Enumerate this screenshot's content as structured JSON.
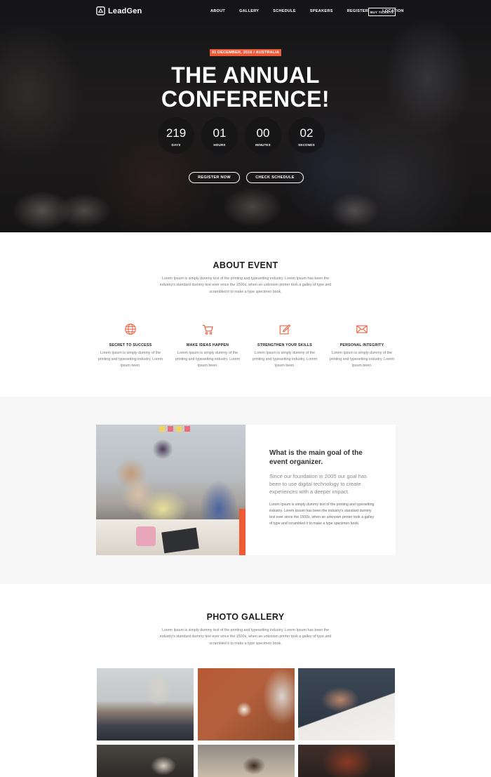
{
  "header": {
    "brand": "LeadGen",
    "nav": [
      "ABOUT",
      "GALLERY",
      "SCHEDULE",
      "SPEAKERS",
      "REGISTER",
      "LOCATION"
    ],
    "cta": "BUY TICKETS"
  },
  "hero": {
    "date_badge": "31 DECEMBER, 2016 / AUSTRALIA",
    "title_line1": "THE ANNUAL",
    "title_line2": "CONFERENCE!",
    "countdown": [
      {
        "value": "219",
        "label": "DAYS"
      },
      {
        "value": "01",
        "label": "HOURS"
      },
      {
        "value": "00",
        "label": "MINUTES"
      },
      {
        "value": "02",
        "label": "SECONDS"
      }
    ],
    "register_label": "REGISTER NOW",
    "schedule_label": "CHECK SCHEDULE"
  },
  "about": {
    "title": "ABOUT EVENT",
    "description": "Lorem Ipsum is simply dummy text of the printing and typesetting industry. Lorem Ipsum has been the industry's standard dummy text ever since the 1500s, when an unknown printer took a galley of type and scrambled it to make a type specimen book.",
    "features": [
      {
        "icon": "globe-icon",
        "title": "SECRET TO SUCCESS",
        "text": "Lorem Ipsum is simply dummy of the printing and typesetting industry. Lorem Ipsum been."
      },
      {
        "icon": "cart-icon",
        "title": "MAKE IDEAS HAPPEN",
        "text": "Lorem Ipsum is simply dummy of the printing and typesetting industry. Lorem Ipsum been."
      },
      {
        "icon": "edit-icon",
        "title": "STRENGTHEN YOUR SKILLS",
        "text": "Lorem Ipsum is simply dummy of the printing and typesetting industry. Lorem Ipsum been."
      },
      {
        "icon": "mail-icon",
        "title": "PERSONAL INTEGRITY",
        "text": "Lorem Ipsum is simply dummy of the printing and typesetting industry. Lorem Ipsum been."
      }
    ]
  },
  "goal": {
    "heading": "What is the main goal of the event organizer.",
    "lead": "Since our foundation in 2005 our goal has been to use digital technology to create experiences with a deeper impact.",
    "body": "Lorem Ipsum is simply dummy text of the printing and typesetting industry. Lorem Ipsum has been the industry's standard dummy text ever since the 1500s, when an unknown printer took a galley of type and scrambled it to make a type specimen book."
  },
  "gallery": {
    "title": "PHOTO GALLERY",
    "description": "Lorem Ipsum is simply dummy text of the printing and typesetting industry. Lorem Ipsum has been the industry's standard dummy text ever since the 1500s, when an unknown printer took a galley of type and scrambled it to make a type specimen book."
  },
  "colors": {
    "accent": "#ee5a3a",
    "dark": "#1c1c1c",
    "muted": "#777777",
    "section_bg": "#f6f6f6"
  }
}
